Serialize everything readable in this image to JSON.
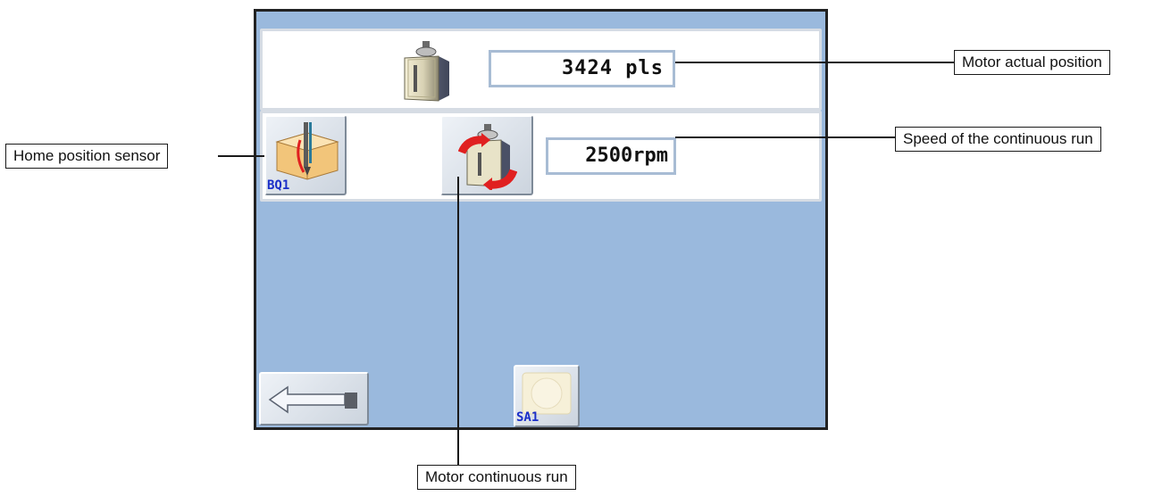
{
  "hmi": {
    "actual_position": "3424 pls",
    "continuous_speed": "2500rpm",
    "home_sensor_tag": "BQ1",
    "switch_tag": "SA1"
  },
  "callouts": {
    "motor_actual_position": "Motor actual position",
    "home_position_sensor": "Home position sensor",
    "speed_continuous_run": "Speed of the continuous run",
    "motor_continuous_run": "Motor continuous run"
  },
  "icons": {
    "motor": "stepper-motor-icon",
    "home_sensor": "home-sensor-icon",
    "continuous_run": "rotation-motor-icon",
    "back": "back-arrow-icon",
    "switch": "switch-icon"
  },
  "colors": {
    "screen_bg": "#9ab9dd",
    "panel_bg": "#ffffff",
    "tag_text": "#1b2fc8",
    "rotation_arrow": "#e02020"
  }
}
